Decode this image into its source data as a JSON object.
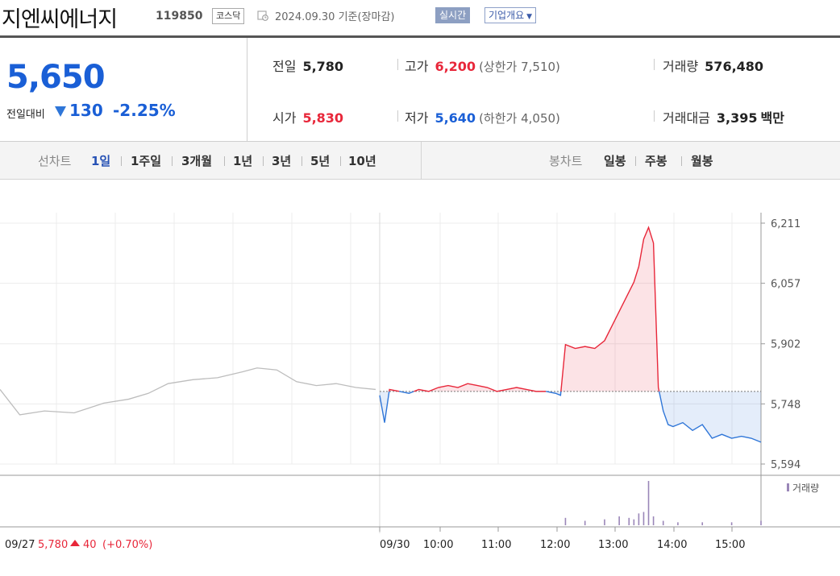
{
  "header": {
    "name": "지엔씨에너지",
    "code": "119850",
    "market": "코스닥",
    "date": "2024.09.30 기준(장마감)",
    "realtime": "실시간",
    "corp_info": "기업개요"
  },
  "price": {
    "current": "5,650",
    "diff_label": "전일대비",
    "diff": "130",
    "diff_pct": "-2.25%",
    "prev_label": "전일",
    "prev": "5,780",
    "open_label": "시가",
    "open": "5,830",
    "high_label": "고가",
    "high": "6,200",
    "upper_limit": "(상한가 7,510)",
    "low_label": "저가",
    "low": "5,640",
    "lower_limit": "(하한가 4,050)",
    "volume_label": "거래량",
    "volume": "576,480",
    "amount_label": "거래대금",
    "amount": "3,395",
    "amount_unit": "백만"
  },
  "tabs": {
    "line_chart": "선차트",
    "periods": [
      "1일",
      "1주일",
      "3개월",
      "1년",
      "3년",
      "5년",
      "10년"
    ],
    "active": "1일",
    "candle_chart": "봉차트",
    "candle": [
      "일봉",
      "주봉",
      "월봉"
    ]
  },
  "colors": {
    "up": "#e8273a",
    "down": "#2f76d8",
    "prev": "#bdbdbd",
    "volume": "#9a86b8",
    "accent": "#1a5fd6"
  },
  "chart_data": {
    "type": "line",
    "ylim": [
      5594,
      6211
    ],
    "yticks": [
      5594,
      5748,
      5902,
      6057,
      6211
    ],
    "ytick_labels": [
      "5,594",
      "5,748",
      "5,902",
      "6,057",
      "6,211"
    ],
    "baseline": 5780,
    "xticks": [
      "09/30",
      "10:00",
      "11:00",
      "12:00",
      "13:00",
      "14:00",
      "15:00"
    ],
    "prev_day_label": "09/27",
    "prev_day_close": "5,780",
    "prev_day_change": "40",
    "prev_day_pct": "(+0.70%)",
    "volume_label": "거래량",
    "series": [
      {
        "x": [
          "09/27 09:00",
          "09/27 09:20",
          "09/27 09:45",
          "09/27 10:15",
          "09/27 10:45",
          "09/27 11:10",
          "09/27 11:30",
          "09/27 11:50",
          "09/27 12:15",
          "09/27 12:40",
          "09/27 13:05",
          "09/27 13:20",
          "09/27 13:40",
          "09/27 14:00",
          "09/27 14:20",
          "09/27 14:40",
          "09/27 15:00",
          "09/27 15:20"
        ],
        "values": [
          5785,
          5720,
          5730,
          5725,
          5750,
          5760,
          5775,
          5800,
          5810,
          5815,
          5830,
          5840,
          5835,
          5805,
          5795,
          5800,
          5790,
          5785
        ]
      },
      {
        "x": [
          "09:00",
          "09:05",
          "09:10",
          "09:20",
          "09:30",
          "09:40",
          "09:50",
          "10:00",
          "10:10",
          "10:20",
          "10:30",
          "10:40",
          "10:50",
          "11:00",
          "11:10",
          "11:20",
          "11:30",
          "11:40",
          "11:50",
          "12:00",
          "12:05",
          "12:10",
          "12:20",
          "12:30",
          "12:40",
          "12:50",
          "13:00",
          "13:10",
          "13:20",
          "13:25",
          "13:30",
          "13:35",
          "13:40",
          "13:45",
          "13:50",
          "13:55",
          "14:00",
          "14:10",
          "14:20",
          "14:30",
          "14:40",
          "14:50",
          "15:00",
          "15:10",
          "15:20",
          "15:30"
        ],
        "values": [
          5770,
          5700,
          5785,
          5780,
          5775,
          5785,
          5780,
          5790,
          5795,
          5790,
          5800,
          5795,
          5790,
          5780,
          5785,
          5790,
          5785,
          5780,
          5780,
          5775,
          5770,
          5900,
          5890,
          5895,
          5890,
          5910,
          5960,
          6010,
          6060,
          6100,
          6170,
          6200,
          6160,
          5790,
          5730,
          5695,
          5690,
          5700,
          5680,
          5695,
          5660,
          5670,
          5660,
          5665,
          5660,
          5650
        ]
      }
    ],
    "volume": {
      "x": [
        "12:10",
        "12:30",
        "12:50",
        "13:05",
        "13:15",
        "13:20",
        "13:25",
        "13:30",
        "13:35",
        "13:40",
        "13:50",
        "14:05",
        "14:30",
        "15:00",
        "15:30"
      ],
      "values": [
        5000,
        3000,
        4000,
        6000,
        5000,
        4000,
        8000,
        9000,
        30000,
        6000,
        3000,
        2000,
        2000,
        2000,
        3000
      ]
    }
  }
}
